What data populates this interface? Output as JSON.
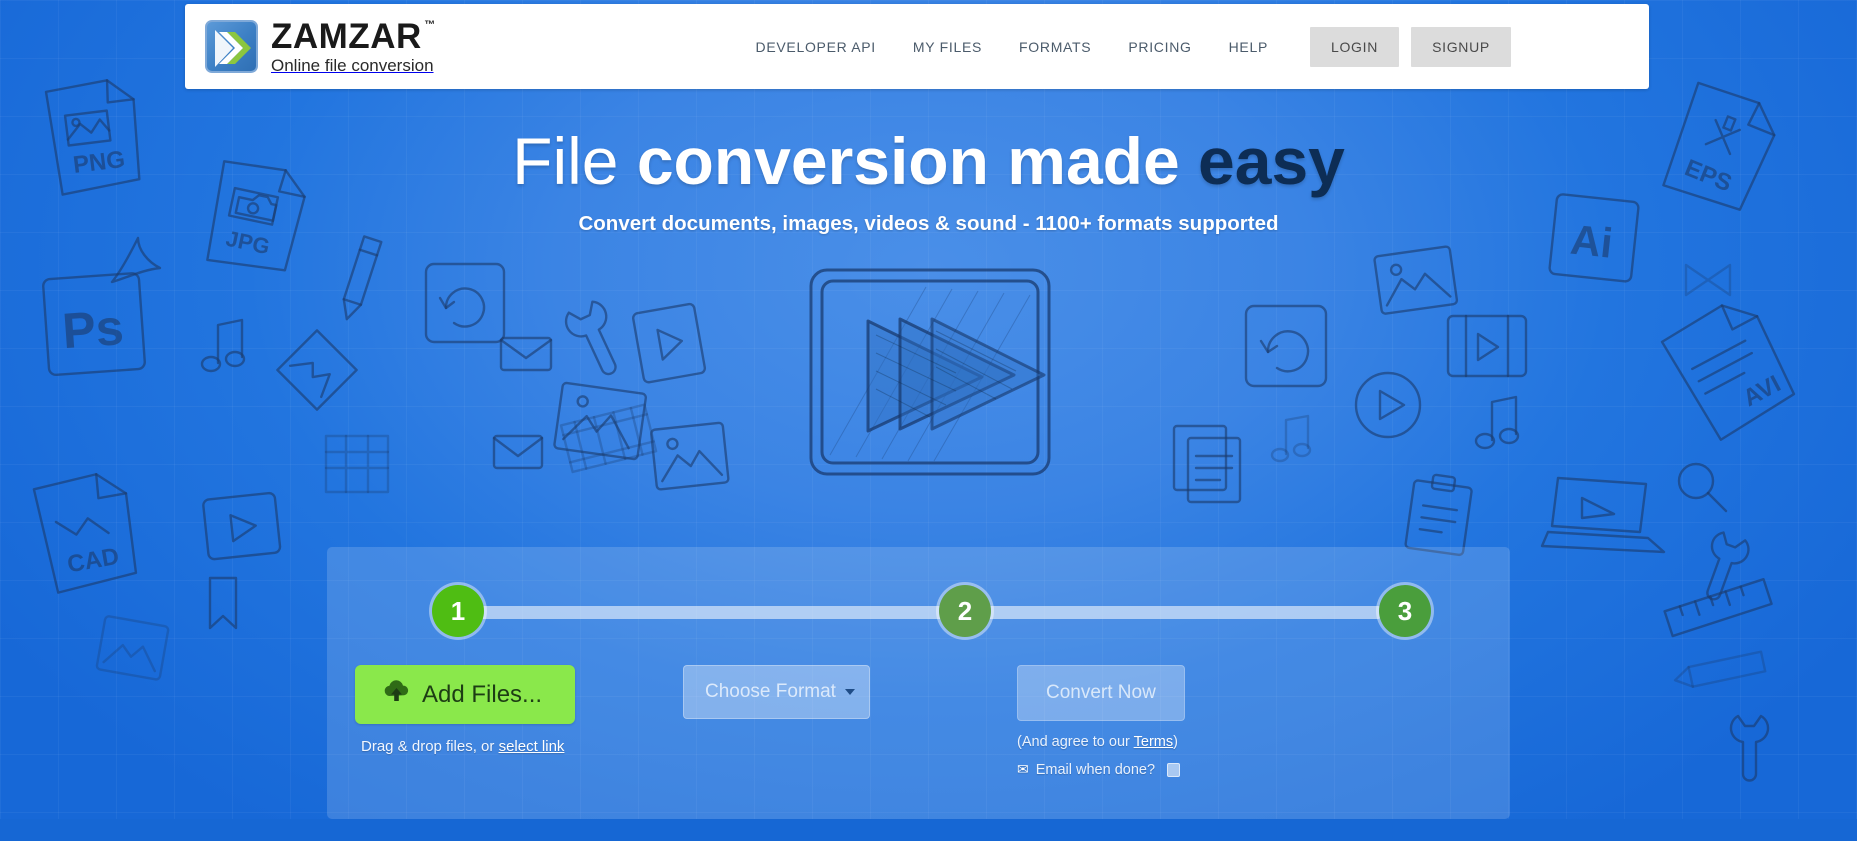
{
  "brand": {
    "name": "ZAMZAR",
    "trademark": "™",
    "tagline": "Online file conversion",
    "logo_icon": "double-chevron-play-logo",
    "accent_green": "#8ae84b",
    "accent_blue": "#3b84e4"
  },
  "nav": {
    "links": [
      {
        "label": "DEVELOPER API",
        "name": "nav-developer-api"
      },
      {
        "label": "MY FILES",
        "name": "nav-my-files"
      },
      {
        "label": "FORMATS",
        "name": "nav-formats"
      },
      {
        "label": "PRICING",
        "name": "nav-pricing"
      },
      {
        "label": "HELP",
        "name": "nav-help"
      }
    ],
    "login_label": "LOGIN",
    "signup_label": "SIGNUP"
  },
  "hero": {
    "headline_part1": "File ",
    "headline_part2": "conversion made ",
    "headline_part3": "easy",
    "subheadline": "Convert documents, images, videos & sound - 1100+ formats supported",
    "icon": "sketch-play-button-icon"
  },
  "converter": {
    "steps": [
      {
        "number": "1",
        "name": "step-1-indicator",
        "color": "#4fbd13"
      },
      {
        "number": "2",
        "name": "step-2-indicator",
        "color": "#5f9e4a"
      },
      {
        "number": "3",
        "name": "step-3-indicator",
        "color": "#4a9e3c"
      }
    ],
    "add_files_label": "Add Files...",
    "add_files_icon": "cloud-upload-icon",
    "dragdrop_prefix": "Drag & drop files, or ",
    "dragdrop_link": "select link",
    "format_placeholder": "Choose Format",
    "format_caret_icon": "chevron-down-icon",
    "convert_label": "Convert Now",
    "terms_prefix": "(And agree to our ",
    "terms_link": "Terms",
    "terms_suffix": ")",
    "email_icon": "✉",
    "email_label": "Email when done?",
    "email_checked": false
  },
  "background": {
    "doodle_labels": [
      "PNG",
      "JPG",
      "Ps",
      "CAD",
      "EPS",
      "Ai",
      "AVI"
    ]
  }
}
